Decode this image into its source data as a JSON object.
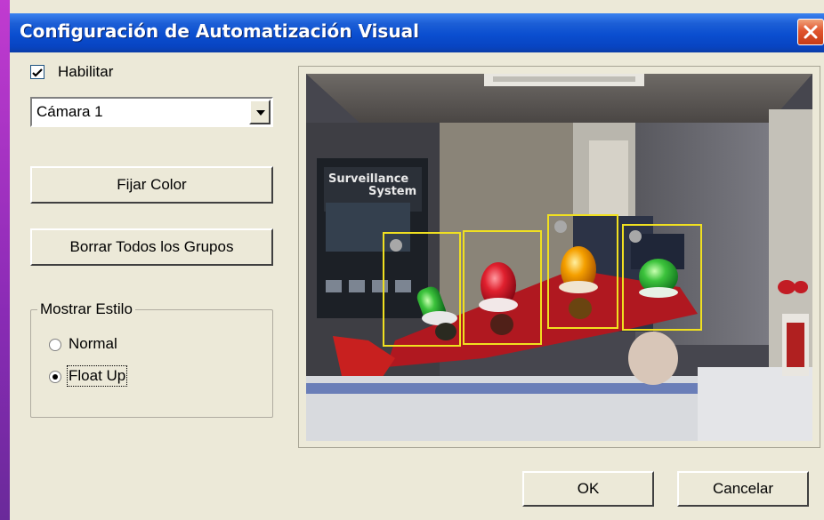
{
  "window": {
    "title": "Configuración de Automatización Visual"
  },
  "settings": {
    "enable_label": "Habilitar",
    "enable_checked": true,
    "camera_select": {
      "value": "Cámara 1"
    }
  },
  "buttons": {
    "set_color": "Fijar Color",
    "clear_groups": "Borrar Todos los Grupos",
    "ok": "OK",
    "cancel": "Cancelar"
  },
  "display_style": {
    "title": "Mostrar Estilo",
    "options": [
      {
        "label": "Normal",
        "selected": false
      },
      {
        "label": "Float Up",
        "selected": true
      }
    ]
  },
  "video": {
    "poster_line1": "Surveillance",
    "poster_line2": "System",
    "detections": [
      {
        "color": "green"
      },
      {
        "color": "red"
      },
      {
        "color": "orange"
      },
      {
        "color": "green"
      }
    ]
  },
  "colors": {
    "titlebar": "#0a4ed0",
    "detection_box": "#f0e020",
    "dialog_bg": "#ece9d8"
  }
}
